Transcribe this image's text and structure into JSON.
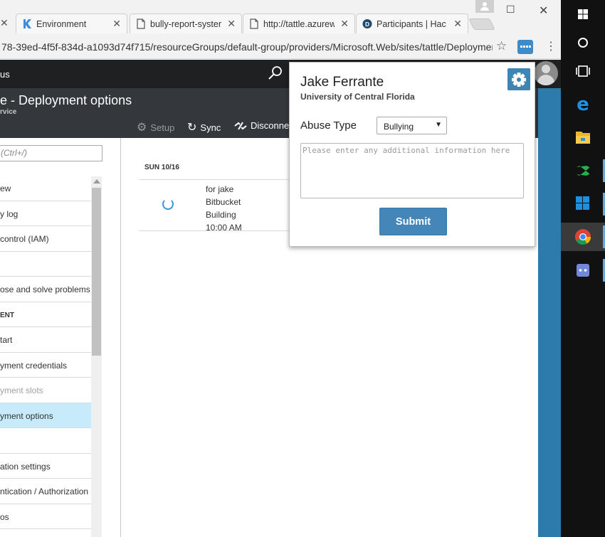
{
  "browser": {
    "tabs": [
      {
        "title": "Environment",
        "favicon": "kudu-icon"
      },
      {
        "title": "bully-report-system",
        "favicon": "page-icon"
      },
      {
        "title": "http://tattle.azurewebsites.net",
        "favicon": "page-icon"
      },
      {
        "title": "Participants | HackNC",
        "favicon": "devpost-icon"
      }
    ],
    "url": "78-39ed-4f5f-834d-a1093d74f715/resourceGroups/default-group/providers/Microsoft.Web/sites/tattle/DeploymentOptions"
  },
  "azure": {
    "brand": "us",
    "blade_title": "e - Deployment options",
    "blade_subtitle": "rvice",
    "commands": {
      "setup": "Setup",
      "sync": "Sync",
      "disconnect": "Disconnect"
    },
    "menu_search_placeholder": "(Ctrl+/)",
    "menu_items": [
      {
        "label": "ew"
      },
      {
        "label": "y log"
      },
      {
        "label": "control (IAM)"
      },
      {
        "label": ""
      },
      {
        "label": "ose and solve problems"
      },
      {
        "label": "ENT"
      },
      {
        "label": "tart"
      },
      {
        "label": "yment credentials"
      },
      {
        "label": "yment slots"
      },
      {
        "label": "yment options"
      },
      {
        "label": ""
      },
      {
        "label": "ation settings"
      },
      {
        "label": "ntication / Authorization"
      },
      {
        "label": "os"
      }
    ],
    "deployment": {
      "date": "SUN 10/16",
      "message": "for jake",
      "source": "Bitbucket",
      "status": "Building",
      "time": "10:00 AM"
    }
  },
  "popup": {
    "name": "Jake Ferrante",
    "university": "University of Central Florida",
    "abuse_label": "Abuse Type",
    "abuse_value": "Bullying",
    "textarea_placeholder": "Please enter any additional information here",
    "submit_label": "Submit",
    "accent_color": "#4386b7"
  },
  "taskbar": {
    "icons": [
      "windows-start-icon",
      "cortana-icon",
      "task-view-icon",
      "edge-icon",
      "file-explorer-icon",
      "visual-studio-icon",
      "windows-store-icon",
      "chrome-icon",
      "discord-icon"
    ]
  }
}
